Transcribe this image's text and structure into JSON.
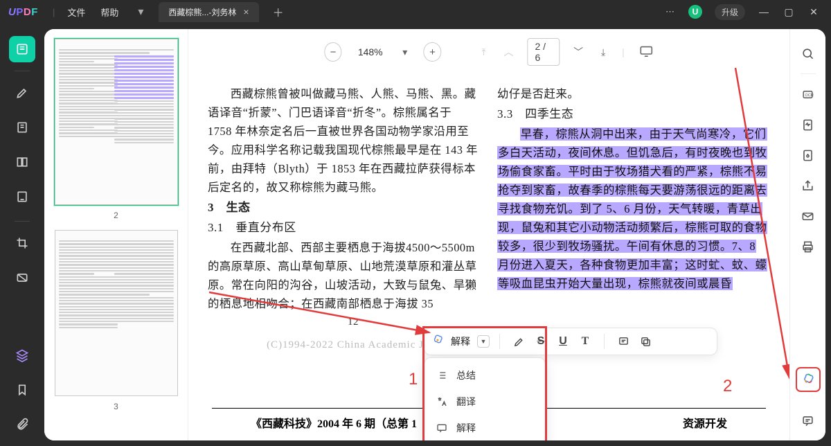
{
  "app": {
    "logo_text": "UPDF",
    "menu": {
      "file": "文件",
      "help": "帮助"
    },
    "tab_title": "西藏棕熊...-刘务林",
    "upgrade": "升级",
    "avatar_initial": "U"
  },
  "toolbar": {
    "zoom": "148%",
    "page_current": "2",
    "page_total": "6"
  },
  "thumbnails": {
    "page2_label": "2",
    "page3_label": "3"
  },
  "content": {
    "left": {
      "p1": "西藏棕熊曾被叫做藏马熊、人熊、马熊、黑。藏语译音“折蒙”、门巴语译音“折冬”。棕熊属名于 1758 年林奈定名后一直被世界各国动物学家沿用至今。应用科学名称记载我国现代棕熊最早是在 143 年前，由拜特（Blyth）于 1853 年在西藏拉萨获得标本后定名的，故又称棕熊为藏马熊。",
      "h3": "3　生态",
      "h31": "3.1　垂直分布区",
      "p2": "在西藏北部、西部主要栖息于海拔4500～5500m 的高原草原、高山草甸草原、山地荒漠草原和灌丛草原。常在向阳的沟谷，山坡活动，大致与鼠兔、旱獭的栖息地相吻合；在西藏南部栖息于海拔 35",
      "pgnum": "12",
      "watermark": "(C)1994-2022 China Academic Jour"
    },
    "right": {
      "lead": "幼仔是否赶来。",
      "h33": "3.3　四季生态",
      "hl": "早春，棕熊从洞中出来，由于天气尚寒冷，它们多白天活动，夜间休息。但饥急后，有时夜晚也到牧场偷食家畜。平时由于牧场猎犬看的严紧，棕熊不易抢夺到家畜，故春季的棕熊每天要游荡很远的距离去寻找食物充饥。到了 5、6 月份，天气转暖，青草出现，鼠兔和其它小动物活动频繁后，棕熊可取的食物较多，很少到牧场骚扰。午间有休息的习惯。7、8 月份进入夏天，各种食物更加丰富；这时虻、蚊、蠓等吸血昆虫开始大量出现，棕熊就夜间或晨昏"
    },
    "footer": {
      "left_pub": "《西藏科技》2004 年 6 期（总第 1",
      "right_label": "资源开发"
    }
  },
  "sel_toolbar": {
    "explain": "解释"
  },
  "ai_menu": {
    "summary": "总结",
    "translate": "翻译",
    "explain": "解释"
  },
  "annotations": {
    "num1": "1",
    "num2": "2"
  }
}
